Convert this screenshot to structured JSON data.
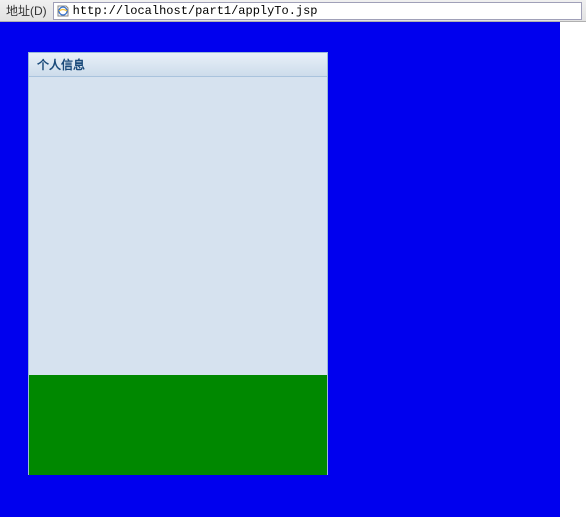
{
  "browser": {
    "address_label": "地址(D)",
    "url": "http://localhost/part1/applyTo.jsp"
  },
  "panel": {
    "title": "个人信息"
  }
}
